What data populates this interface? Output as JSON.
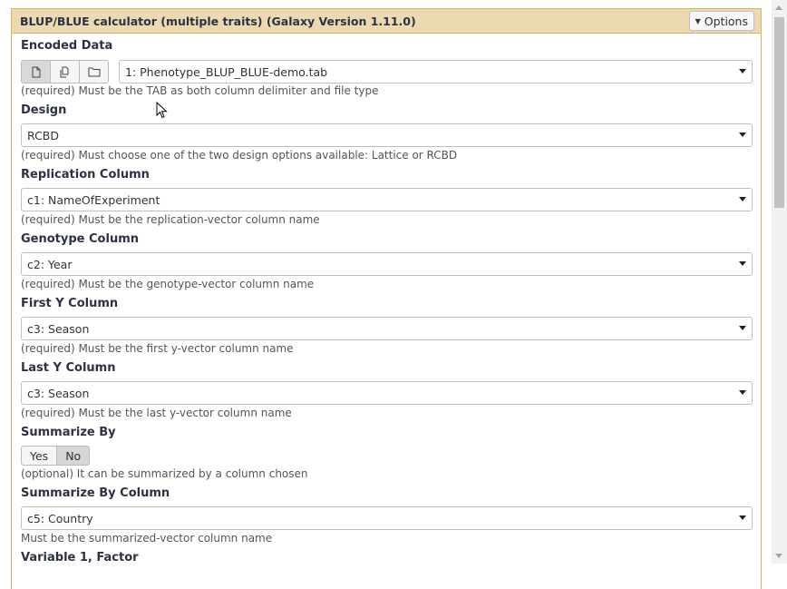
{
  "header": {
    "title": "BLUP/BLUE calculator (multiple traits) (Galaxy Version 1.11.0)",
    "options_label": "Options"
  },
  "encoded_data": {
    "label": "Encoded Data",
    "value": "1: Phenotype_BLUP_BLUE-demo.tab",
    "help": "(required) Must be the TAB as both column delimiter and file type"
  },
  "design": {
    "label": "Design",
    "value": "RCBD",
    "help": "(required) Must choose one of the two design options available: Lattice or RCBD"
  },
  "replication_column": {
    "label": "Replication Column",
    "value": "c1: NameOfExperiment",
    "help": "(required) Must be the replication-vector column name"
  },
  "genotype_column": {
    "label": "Genotype Column",
    "value": "c2: Year",
    "help": "(required) Must be the genotype-vector column name"
  },
  "first_y_column": {
    "label": "First Y Column",
    "value": "c3: Season",
    "help": "(required) Must be the first y-vector column name"
  },
  "last_y_column": {
    "label": "Last Y Column",
    "value": "c3: Season",
    "help": "(required) Must be the last y-vector column name"
  },
  "summarize_by": {
    "label": "Summarize By",
    "yes": "Yes",
    "no": "No",
    "selected": "No",
    "help": "(optional) It can be summarized by a column chosen"
  },
  "summarize_by_column": {
    "label": "Summarize By Column",
    "value": "c5: Country",
    "help": "Must be the summarized-vector column name"
  },
  "variable_1": {
    "label": "Variable 1, Factor"
  },
  "icons": [
    "file-icon",
    "copy-files-icon",
    "folder-icon",
    "caret-down-icon",
    "mouse-cursor-icon"
  ]
}
